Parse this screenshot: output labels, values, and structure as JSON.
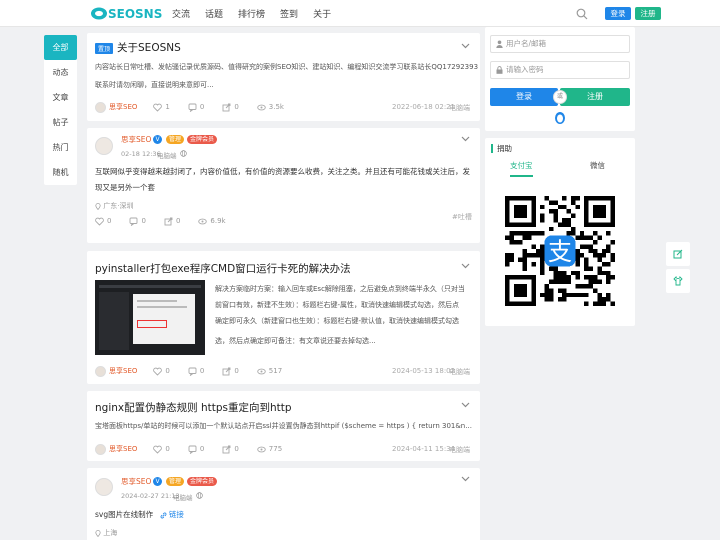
{
  "header": {
    "logo_text": "SEOSNS",
    "nav": [
      "交流",
      "话题",
      "排行榜",
      "签到",
      "关于"
    ],
    "login": "登录",
    "register": "注册"
  },
  "leftnav": [
    "全部",
    "动态",
    "文章",
    "帖子",
    "热门",
    "随机"
  ],
  "posts": {
    "p1": {
      "tag": "置顶",
      "title": "关于SEOSNS",
      "desc1": "内容站长日常吐槽、发帖骚记录优质源码、值得研究的案例SEO知识、建站知识、编程知识交流学习联系站长QQ17292393",
      "desc2": "联系时请勿闲聊，直接说明来意即可...",
      "author": "思享SEO",
      "likes": "1",
      "comments": "0",
      "shares": "0",
      "views": "3.5k",
      "date": "2022-06-18 02:21",
      "device": "电脑端"
    },
    "p2": {
      "author": "思享SEO",
      "badge_v": "V",
      "badge_level": "管理",
      "badge_vip": "金牌会员",
      "time": "02-18 12:36",
      "device": "电脑端",
      "text1": "互联网似乎变得越来越封闭了，内容价值低，有价值的资源要么收费，关注之类。并且还有可能花钱或关注后，发",
      "text2": "现又是另外一个套",
      "location": "广东·深圳",
      "likes": "0",
      "comments": "0",
      "shares": "0",
      "views": "6.9k",
      "topic": "#吐槽"
    },
    "p3": {
      "title": "pyinstaller打包exe程序CMD窗口运行卡死的解决办法",
      "l1": "解决方案临时方案：输入回车或Esc解除阻塞，之后避免点到终端半永久（只对当",
      "l2": "前窗口有效，新建不生效）：标题栏右键-属性，取消快速编辑模式勾选，然后点",
      "l3": "确定即可永久（新建窗口也生效）：标题栏右键-默认值，取消快速编辑模式勾选",
      "l4": "选，然后点确定即可备注：有文章说还要去掉勾选...",
      "author": "思享SEO",
      "likes": "0",
      "comments": "0",
      "shares": "0",
      "views": "517",
      "date": "2024-05-13 18:02",
      "device": "电脑端"
    },
    "p4": {
      "title": "nginx配置伪静态规则 https重定向到http",
      "desc": "宝塔面板https/单站的时候可以添加一个默认站点开启ssl并设置伪静态到httpif ($scheme = https ) {      return 301&n...",
      "author": "思享SEO",
      "likes": "0",
      "comments": "0",
      "shares": "0",
      "views": "775",
      "date": "2024-04-11 15:34",
      "device": "电脑端"
    },
    "p5": {
      "author": "思享SEO",
      "badge_v": "V",
      "badge_level": "管理",
      "badge_vip": "金牌会员",
      "time": "2024-02-27 21:13",
      "device": "电脑端",
      "text": "svg图片在线制作",
      "link": "链接",
      "location": "上海"
    }
  },
  "login_box": {
    "user_placeholder": "用户名/邮箱",
    "pwd_placeholder": "请输入密码",
    "login": "登录",
    "or": "或",
    "register": "注册"
  },
  "donate": {
    "title": "捐助",
    "tab_alipay": "支付宝",
    "tab_wechat": "微信"
  },
  "colors": {
    "accent": "#1ab5c1",
    "blue": "#1f86e8",
    "green": "#20b68a",
    "author": "#e25a2a"
  }
}
